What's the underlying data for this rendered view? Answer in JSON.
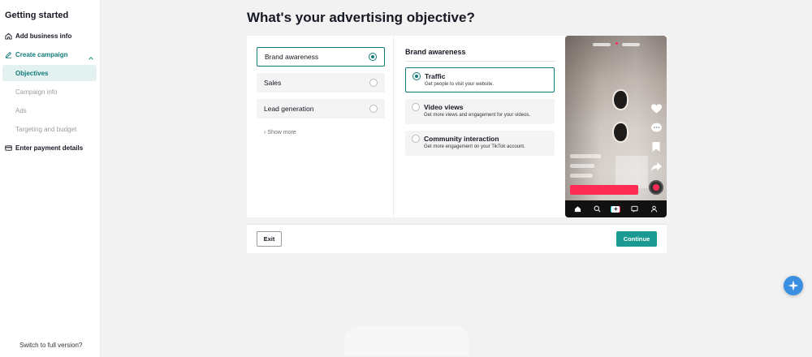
{
  "sidebar": {
    "title": "Getting started",
    "items": [
      {
        "label": "Add business info",
        "icon": "home-icon"
      },
      {
        "label": "Create campaign",
        "icon": "edit-icon"
      },
      {
        "label": "Enter payment details",
        "icon": "card-icon"
      }
    ],
    "sub_items": [
      "Objectives",
      "Campaign info",
      "Ads",
      "Targeting and budget"
    ],
    "footer": "Switch to full version?"
  },
  "main": {
    "title": "What's your advertising objective?",
    "objectives": [
      "Brand awareness",
      "Sales",
      "Lead generation"
    ],
    "selected_objective": "Brand awareness",
    "show_more": "Show more",
    "detail": {
      "title": "Brand awareness",
      "options": [
        {
          "title": "Traffic",
          "desc": "Get people to visit your website.",
          "selected": true
        },
        {
          "title": "Video views",
          "desc": "Get more views and engagement for your videos.",
          "selected": false
        },
        {
          "title": "Community interaction",
          "desc": "Get more engagement on your TikTok account.",
          "selected": false
        }
      ]
    }
  },
  "footer": {
    "exit_label": "Exit",
    "continue_label": "Continue"
  },
  "colors": {
    "accent": "#127a7a",
    "continue": "#1a9a92",
    "tiktok_red": "#fe2c55"
  }
}
